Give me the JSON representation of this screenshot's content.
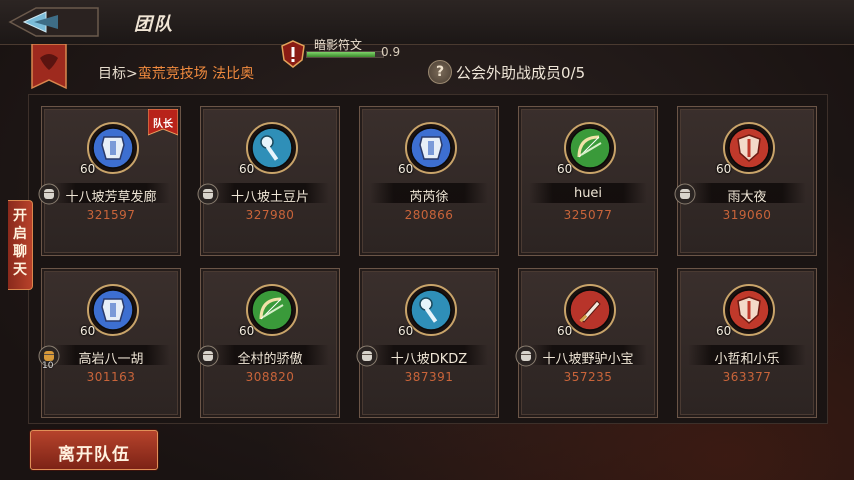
{
  "header": {
    "title": "团队"
  },
  "target": {
    "prefix": "目标>",
    "location": "蛮荒竞技场 法比奥"
  },
  "rune": {
    "name": "暗影符文",
    "value_text": "0.9",
    "value": 0.9
  },
  "guild": {
    "label": "公会外助战成员0/5"
  },
  "chat_button": {
    "label": "开启聊天"
  },
  "leave_button": {
    "label": "离开队伍"
  },
  "leader_label": "队长",
  "members": [
    {
      "name": "十八坡芳草发廊",
      "power": "321597",
      "level": "60",
      "icon": "armor-icon",
      "icon_color": "#3d6fd1",
      "rank_badge": "fist-icon",
      "rank_num": ""
    },
    {
      "name": "十八坡土豆片",
      "power": "327980",
      "level": "60",
      "icon": "key-icon",
      "icon_color": "#2f8fb8",
      "rank_badge": "fist-icon",
      "rank_num": ""
    },
    {
      "name": "芮芮徐",
      "power": "280866",
      "level": "60",
      "icon": "armor-icon",
      "icon_color": "#3d6fd1",
      "rank_badge": "",
      "rank_num": ""
    },
    {
      "name": "huei",
      "power": "325077",
      "level": "60",
      "icon": "bow-icon",
      "icon_color": "#3a9a3a",
      "rank_badge": "",
      "rank_num": ""
    },
    {
      "name": "雨大夜",
      "power": "319060",
      "level": "60",
      "icon": "shield-icon",
      "icon_color": "#c0392b",
      "rank_badge": "fist-icon",
      "rank_num": ""
    },
    {
      "name": "高岩八一胡",
      "power": "301163",
      "level": "60",
      "icon": "armor-icon",
      "icon_color": "#3d6fd1",
      "rank_badge": "fist-gold-icon",
      "rank_num": "10"
    },
    {
      "name": "全村的骄傲",
      "power": "308820",
      "level": "60",
      "icon": "bow-icon",
      "icon_color": "#3a9a3a",
      "rank_badge": "fist-icon",
      "rank_num": ""
    },
    {
      "name": "十八坡DKDZ",
      "power": "387391",
      "level": "60",
      "icon": "key-icon",
      "icon_color": "#2f8fb8",
      "rank_badge": "fist-icon",
      "rank_num": ""
    },
    {
      "name": "十八坡野驴小宝",
      "power": "357235",
      "level": "60",
      "icon": "dagger-icon",
      "icon_color": "#b8342a",
      "rank_badge": "fist-icon",
      "rank_num": ""
    },
    {
      "name": "小哲和小乐",
      "power": "363377",
      "level": "60",
      "icon": "shield-icon",
      "icon_color": "#c0392b",
      "rank_badge": "",
      "rank_num": ""
    }
  ]
}
